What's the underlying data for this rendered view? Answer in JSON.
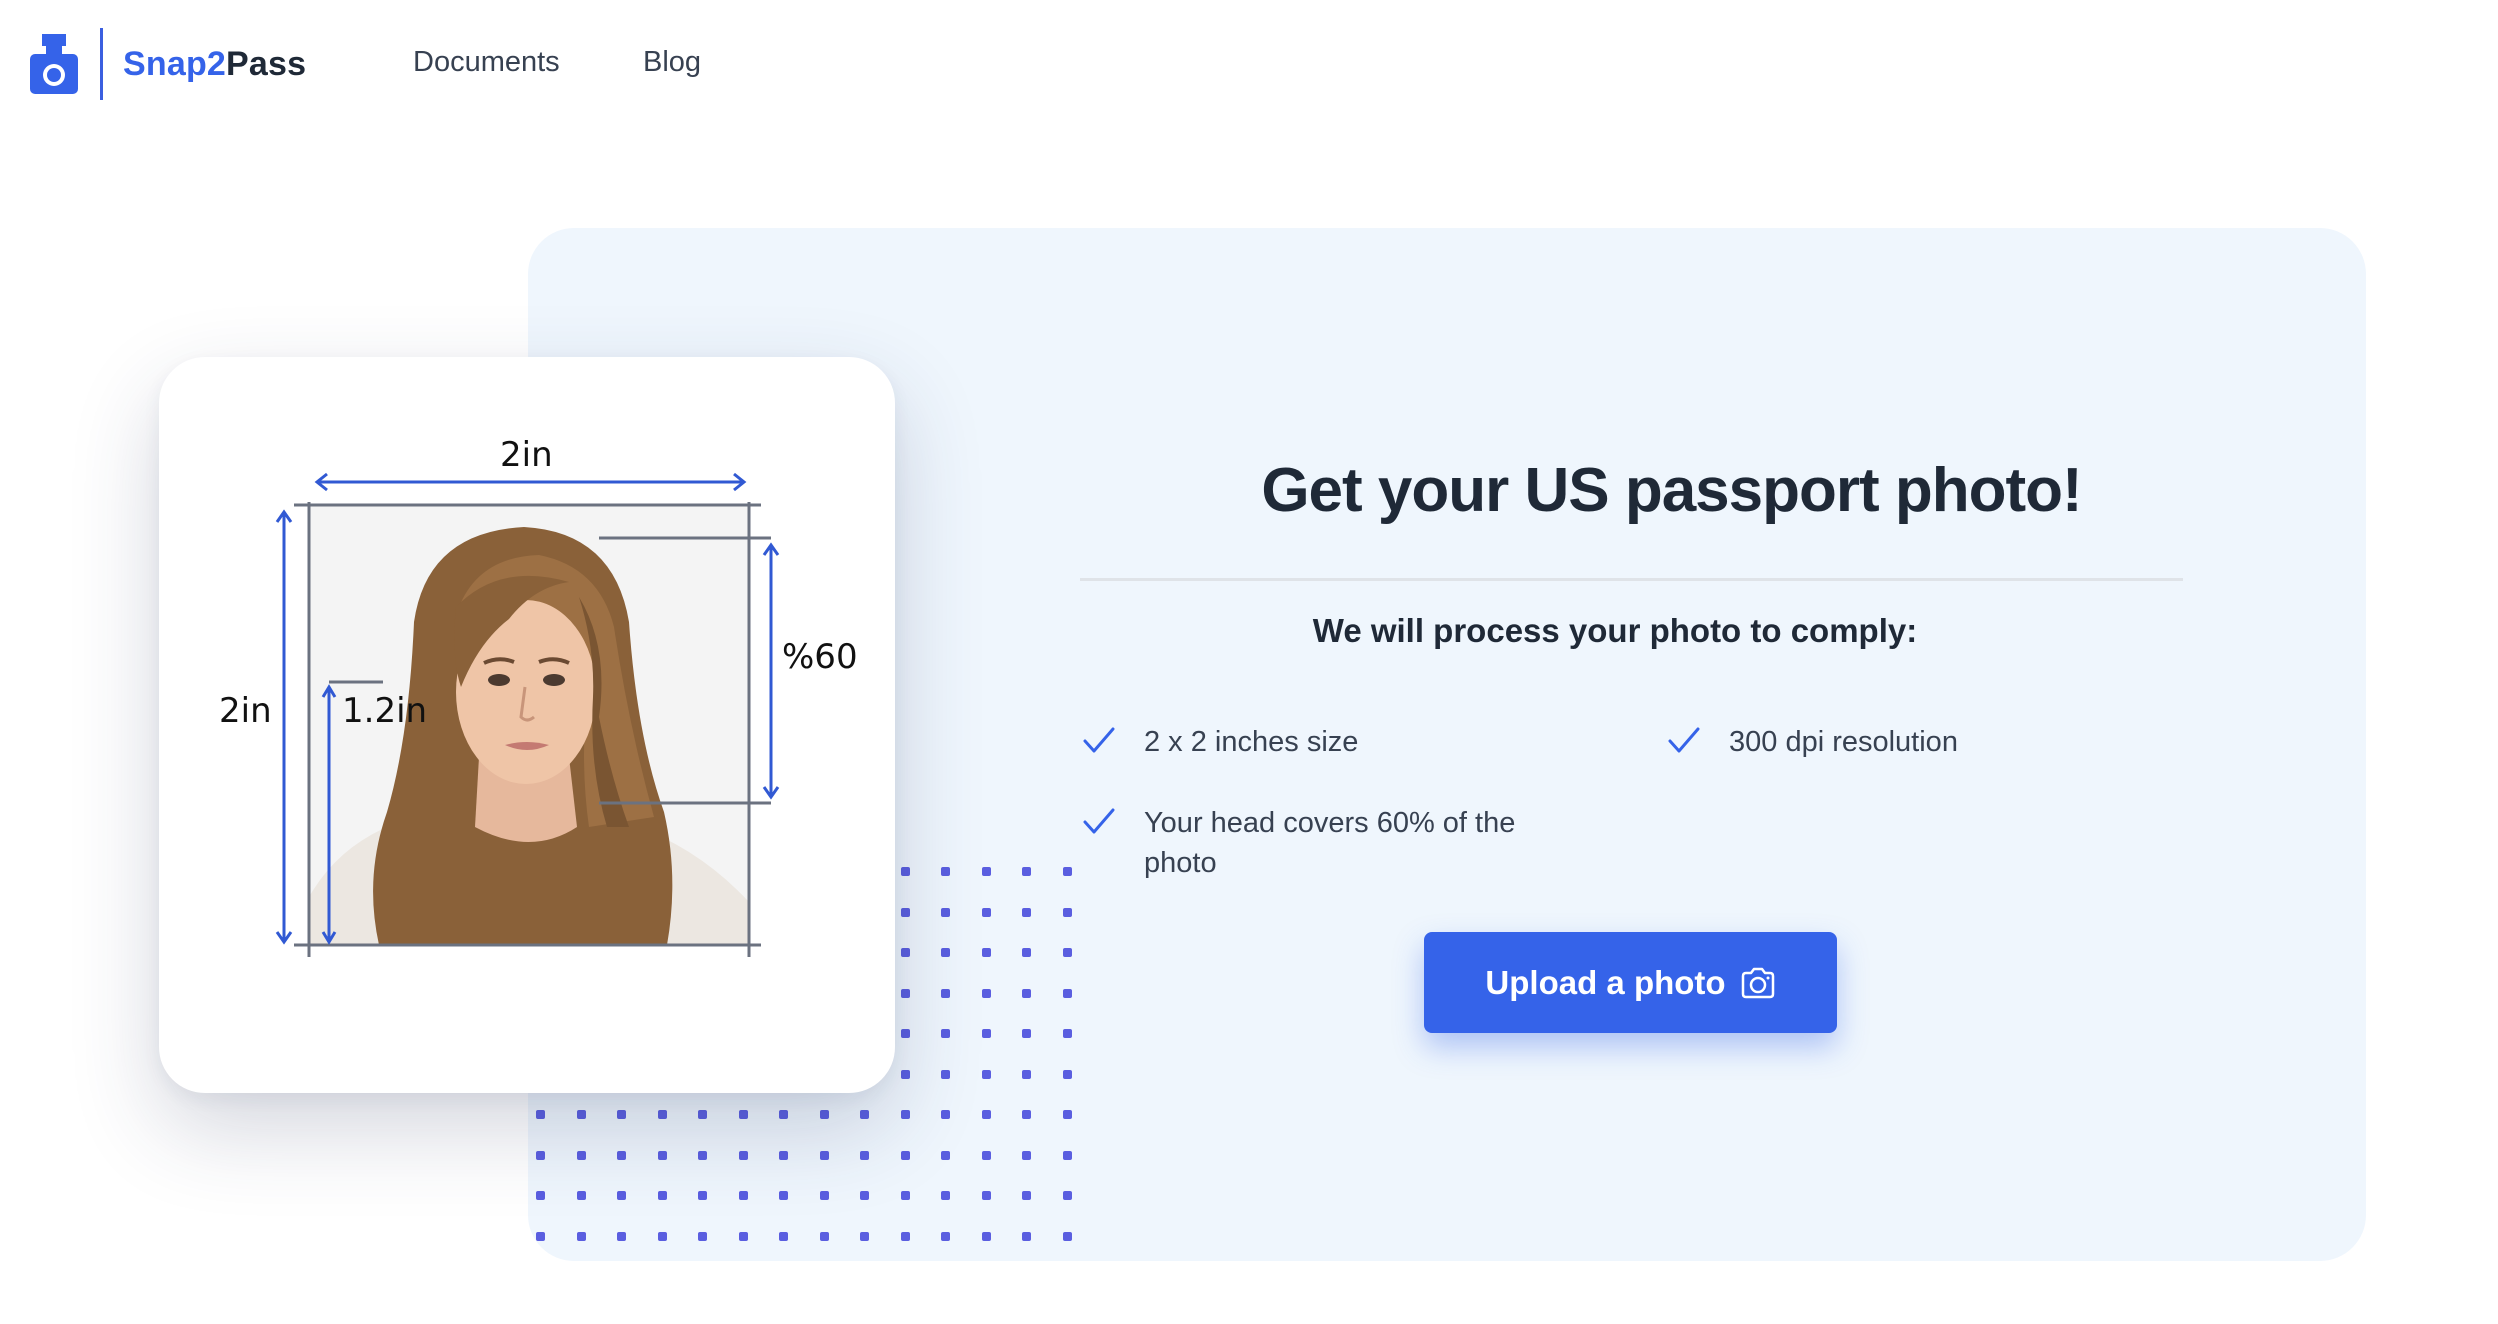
{
  "brand": {
    "name_part1": "Snap2",
    "name_part2": "Pass"
  },
  "nav": {
    "items": [
      {
        "label": "Documents"
      },
      {
        "label": "Blog"
      }
    ]
  },
  "photo_card": {
    "width_label": "2in",
    "height_label": "2in",
    "chin_label": "1.2in",
    "head_label": "%60"
  },
  "hero": {
    "title": "Get your US passport photo!",
    "subtitle": "We will process your photo to comply:",
    "requirements": [
      {
        "text": "2 x 2 inches size",
        "icon": "check-icon"
      },
      {
        "text": "300 dpi resolution",
        "icon": "check-icon"
      },
      {
        "text": "Your head covers 60% of the photo",
        "icon": "check-icon"
      }
    ],
    "upload_label": "Upload a photo",
    "upload_icon": "camera-icon"
  },
  "colors": {
    "accent": "#3563e9",
    "panel_bg": "#eff6fd",
    "dots": "#5a5ee0"
  }
}
